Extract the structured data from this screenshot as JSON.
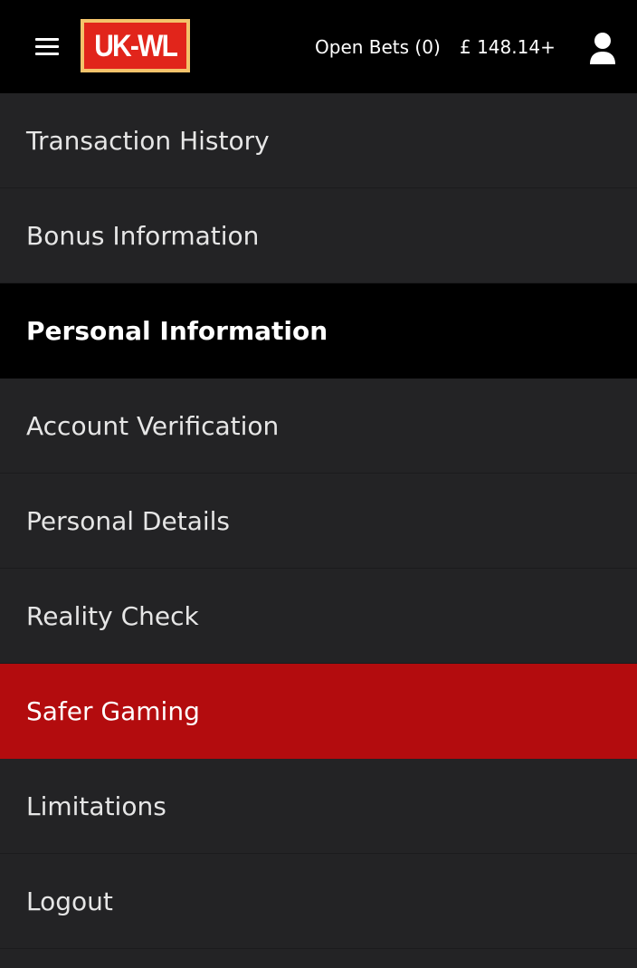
{
  "header": {
    "logo_text": "UK-WL",
    "open_bets_label": "Open Bets (0)",
    "balance": "£ 148.14+",
    "icons": {
      "menu": "hamburger-menu-icon",
      "user": "user-icon"
    }
  },
  "menu": {
    "items": [
      {
        "label": "Transaction History",
        "kind": "link"
      },
      {
        "label": "Bonus Information",
        "kind": "link"
      },
      {
        "label": "Personal Information",
        "kind": "heading"
      },
      {
        "label": "Account Verification",
        "kind": "link"
      },
      {
        "label": "Personal Details",
        "kind": "link"
      },
      {
        "label": "Reality Check",
        "kind": "link"
      },
      {
        "label": "Safer Gaming",
        "kind": "link",
        "active": true
      },
      {
        "label": "Limitations",
        "kind": "link"
      },
      {
        "label": "Logout",
        "kind": "link"
      }
    ]
  },
  "colors": {
    "header_bg": "#000000",
    "menu_bg": "#232325",
    "heading_bg": "#000000",
    "active_bg": "#b30c0e",
    "logo_red": "#e1251b",
    "logo_border": "#f3c36b"
  }
}
